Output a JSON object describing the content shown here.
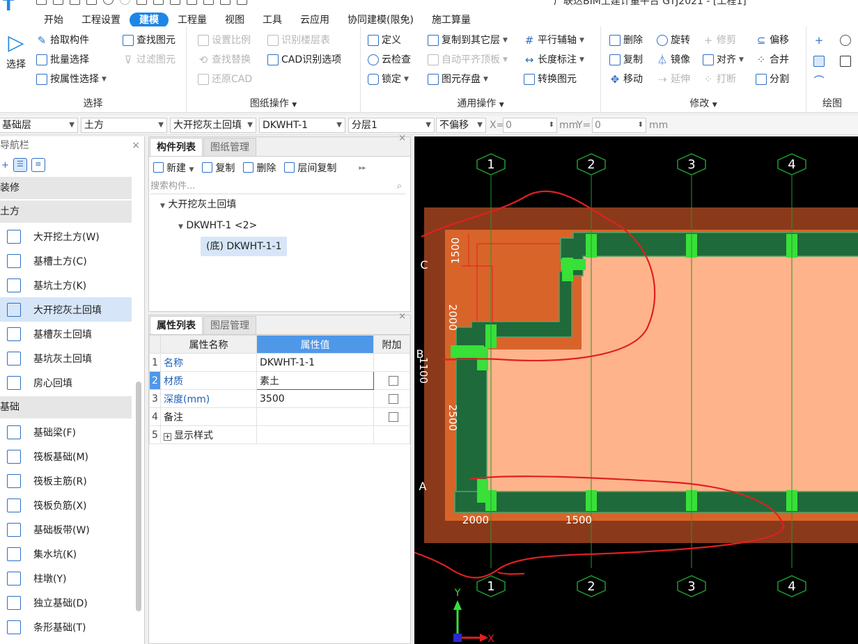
{
  "window": {
    "title": "广联达BIM土建计量平台 GTJ2021 - [工程1]",
    "menu_tabs": [
      "开始",
      "工程设置",
      "建模",
      "工程量",
      "视图",
      "工具",
      "云应用",
      "协同建模(限免)",
      "施工算量"
    ],
    "active_tab": "建模"
  },
  "ribbon": {
    "select_big_label": "选择",
    "select_group": {
      "title": "选择",
      "pick": "拾取构件",
      "batch": "批量选择",
      "by_attr": "按属性选择",
      "find": "查找图元",
      "filter": "过滤图元"
    },
    "drawing_group": {
      "title": "图纸操作",
      "set_scale": "设置比例",
      "identify_floor": "识别楼层表",
      "find_replace": "查找替换",
      "cad_options": "CAD识别选项",
      "restore_cad": "还原CAD"
    },
    "common_group": {
      "title": "通用操作",
      "define": "定义",
      "copy_to_floor": "复制到其它层",
      "parallel_axis": "平行辅轴",
      "cloud_check": "云检查",
      "auto_flat": "自动平齐顶板",
      "length_dim": "长度标注",
      "lock": "锁定",
      "save_element": "图元存盘",
      "convert": "转换图元"
    },
    "modify_group": {
      "title": "修改",
      "delete": "删除",
      "rotate": "旋转",
      "trim": "修剪",
      "offset": "偏移",
      "copy": "复制",
      "mirror": "镜像",
      "align": "对齐",
      "merge": "合并",
      "move": "移动",
      "extend": "延伸",
      "break": "打断",
      "split": "分割"
    },
    "draw_group": {
      "title": "绘图"
    }
  },
  "propbar": {
    "floor": "基础层",
    "category": "土方",
    "type": "大开挖灰土回填",
    "element": "DKWHT-1",
    "layer": "分层1",
    "offset_mode": "不偏移",
    "x_label": "X=",
    "x_value": "0",
    "y_label": "Y=",
    "y_value": "0",
    "unit": "mm"
  },
  "nav": {
    "title": "导航栏",
    "categories": [
      {
        "label": "装修",
        "items": []
      },
      {
        "label": "土方",
        "items": [
          {
            "label": "大开挖土方(W)",
            "icon": "excavation-icon",
            "selected": false
          },
          {
            "label": "基槽土方(C)",
            "icon": "trench-icon",
            "selected": false
          },
          {
            "label": "基坑土方(K)",
            "icon": "pit-icon",
            "selected": false
          },
          {
            "label": "大开挖灰土回填",
            "icon": "backfill-icon",
            "selected": true
          },
          {
            "label": "基槽灰土回填",
            "icon": "trench-backfill-icon",
            "selected": false
          },
          {
            "label": "基坑灰土回填",
            "icon": "pit-backfill-icon",
            "selected": false
          },
          {
            "label": "房心回填",
            "icon": "room-backfill-icon",
            "selected": false
          }
        ]
      },
      {
        "label": "基础",
        "items": [
          {
            "label": "基础梁(F)",
            "icon": "beam-icon",
            "selected": false
          },
          {
            "label": "筏板基础(M)",
            "icon": "raft-icon",
            "selected": false
          },
          {
            "label": "筏板主筋(R)",
            "icon": "main-rebar-icon",
            "selected": false
          },
          {
            "label": "筏板负筋(X)",
            "icon": "neg-rebar-icon",
            "selected": false
          },
          {
            "label": "基础板带(W)",
            "icon": "strip-icon",
            "selected": false
          },
          {
            "label": "集水坑(K)",
            "icon": "sump-icon",
            "selected": false
          },
          {
            "label": "柱墩(Y)",
            "icon": "pier-icon",
            "selected": false
          },
          {
            "label": "独立基础(D)",
            "icon": "footing-icon",
            "selected": false
          },
          {
            "label": "条形基础(T)",
            "icon": "strip-footing-icon",
            "selected": false
          }
        ]
      }
    ]
  },
  "component_panel": {
    "tabs": [
      "构件列表",
      "图纸管理"
    ],
    "toolbar": {
      "new": "新建",
      "copy": "复制",
      "delete": "删除",
      "floor_copy": "层间复制"
    },
    "search_placeholder": "搜索构件...",
    "tree": {
      "root": "大开挖灰土回填",
      "group": "DKWHT-1 <2>",
      "leaf": "(底) DKWHT-1-1"
    }
  },
  "property_panel": {
    "tabs": [
      "属性列表",
      "图层管理"
    ],
    "headers": {
      "name": "属性名称",
      "value": "属性值",
      "extra": "附加"
    },
    "rows": [
      {
        "num": "1",
        "name": "名称",
        "value": "DKWHT-1-1",
        "check": false
      },
      {
        "num": "2",
        "name": "材质",
        "value": "素土",
        "check": true
      },
      {
        "num": "3",
        "name": "深度(mm)",
        "value": "3500",
        "check": true
      },
      {
        "num": "4",
        "name": "备注",
        "value": "",
        "check": true
      },
      {
        "num": "5",
        "name": "显示样式",
        "value": "",
        "check": null
      }
    ]
  },
  "canvas": {
    "axis_labels_top": [
      "1",
      "2",
      "3",
      "4"
    ],
    "axis_labels_bottom": [
      "1",
      "2",
      "3",
      "4"
    ],
    "side_labels": [
      "C",
      "B",
      "A"
    ],
    "dims": [
      "1500",
      "2000",
      "1100",
      "2500",
      "2000",
      "1500"
    ],
    "ucs_x": "X",
    "ucs_y": "Y",
    "colors": {
      "background": "#000000",
      "outer": "#8a3a1a",
      "inner": "#d9642a",
      "fill": "#ffb38a",
      "wall": "#1f6a3a",
      "post": "#38e038",
      "markup": "#e02020"
    }
  }
}
